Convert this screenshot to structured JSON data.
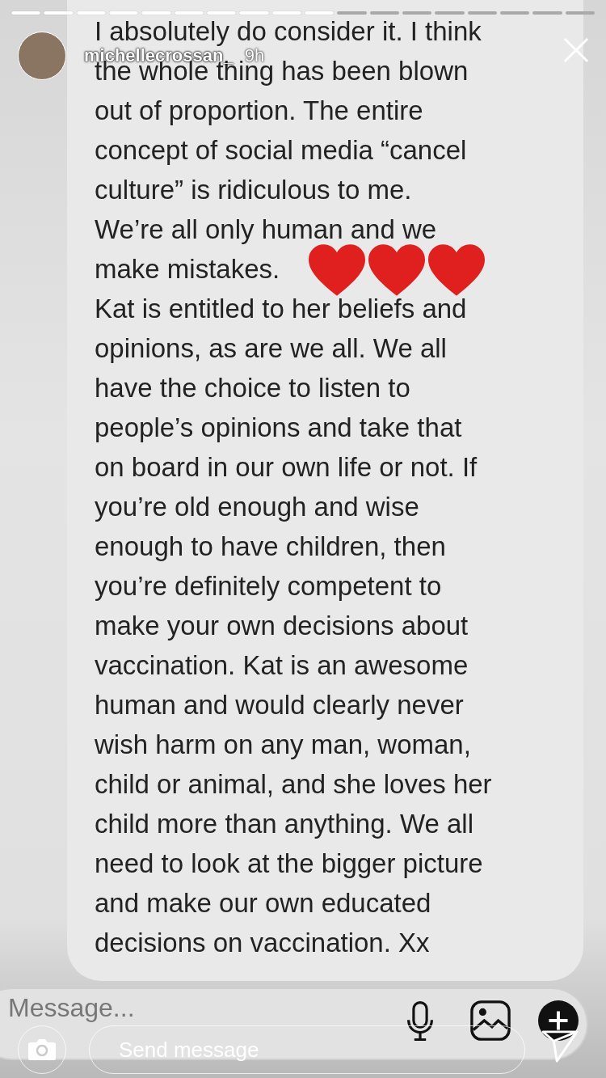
{
  "story": {
    "username": "michellecrossan_",
    "time": "9h",
    "segments": [
      {
        "viewed": true
      },
      {
        "viewed": true
      },
      {
        "viewed": true
      },
      {
        "viewed": true
      },
      {
        "viewed": true
      },
      {
        "viewed": true
      },
      {
        "viewed": true
      },
      {
        "viewed": true
      },
      {
        "viewed": true
      },
      {
        "viewed": true
      },
      {
        "viewed": false
      },
      {
        "viewed": false
      },
      {
        "viewed": false
      },
      {
        "viewed": false
      },
      {
        "viewed": false
      },
      {
        "viewed": false
      },
      {
        "viewed": false
      },
      {
        "viewed": false
      }
    ],
    "reply_placeholder": "Send message"
  },
  "message_lines": [
    {
      "text": "I absolutely do consider it. I think"
    },
    {
      "text": "the whole thing has been blown"
    },
    {
      "text": "out of proportion. The entire"
    },
    {
      "text": "concept of social media “cancel"
    },
    {
      "text": "culture” is ridiculous to me."
    },
    {
      "text": "We’re all only human and we"
    },
    {
      "text": "make mistakes.",
      "emoji": [
        {
          "kind": "heart"
        },
        {
          "kind": "heart"
        },
        {
          "kind": "heart"
        }
      ]
    },
    {
      "text": "Kat is entitled to her beliefs and"
    },
    {
      "text": "opinions, as are we all. We all"
    },
    {
      "text": "have the choice to listen to"
    },
    {
      "text": "people’s opinions and take that"
    },
    {
      "text": "on board in our own life or not. If"
    },
    {
      "text": "you’re old enough and wise"
    },
    {
      "text": "enough to have children, then"
    },
    {
      "text": "you’re definitely competent to"
    },
    {
      "text": "make your own decisions about"
    },
    {
      "text": "vaccination. Kat is an awesome"
    },
    {
      "text": "human and would clearly never"
    },
    {
      "text": "wish harm on any man, woman,"
    },
    {
      "text": "child or animal, and she loves her"
    },
    {
      "text": "child more than anything. We all"
    },
    {
      "text": "need to look at the bigger picture"
    },
    {
      "text": "and make our own educated"
    },
    {
      "text": "decisions on vaccination. Xx"
    }
  ],
  "composer": {
    "placeholder": "Message..."
  }
}
